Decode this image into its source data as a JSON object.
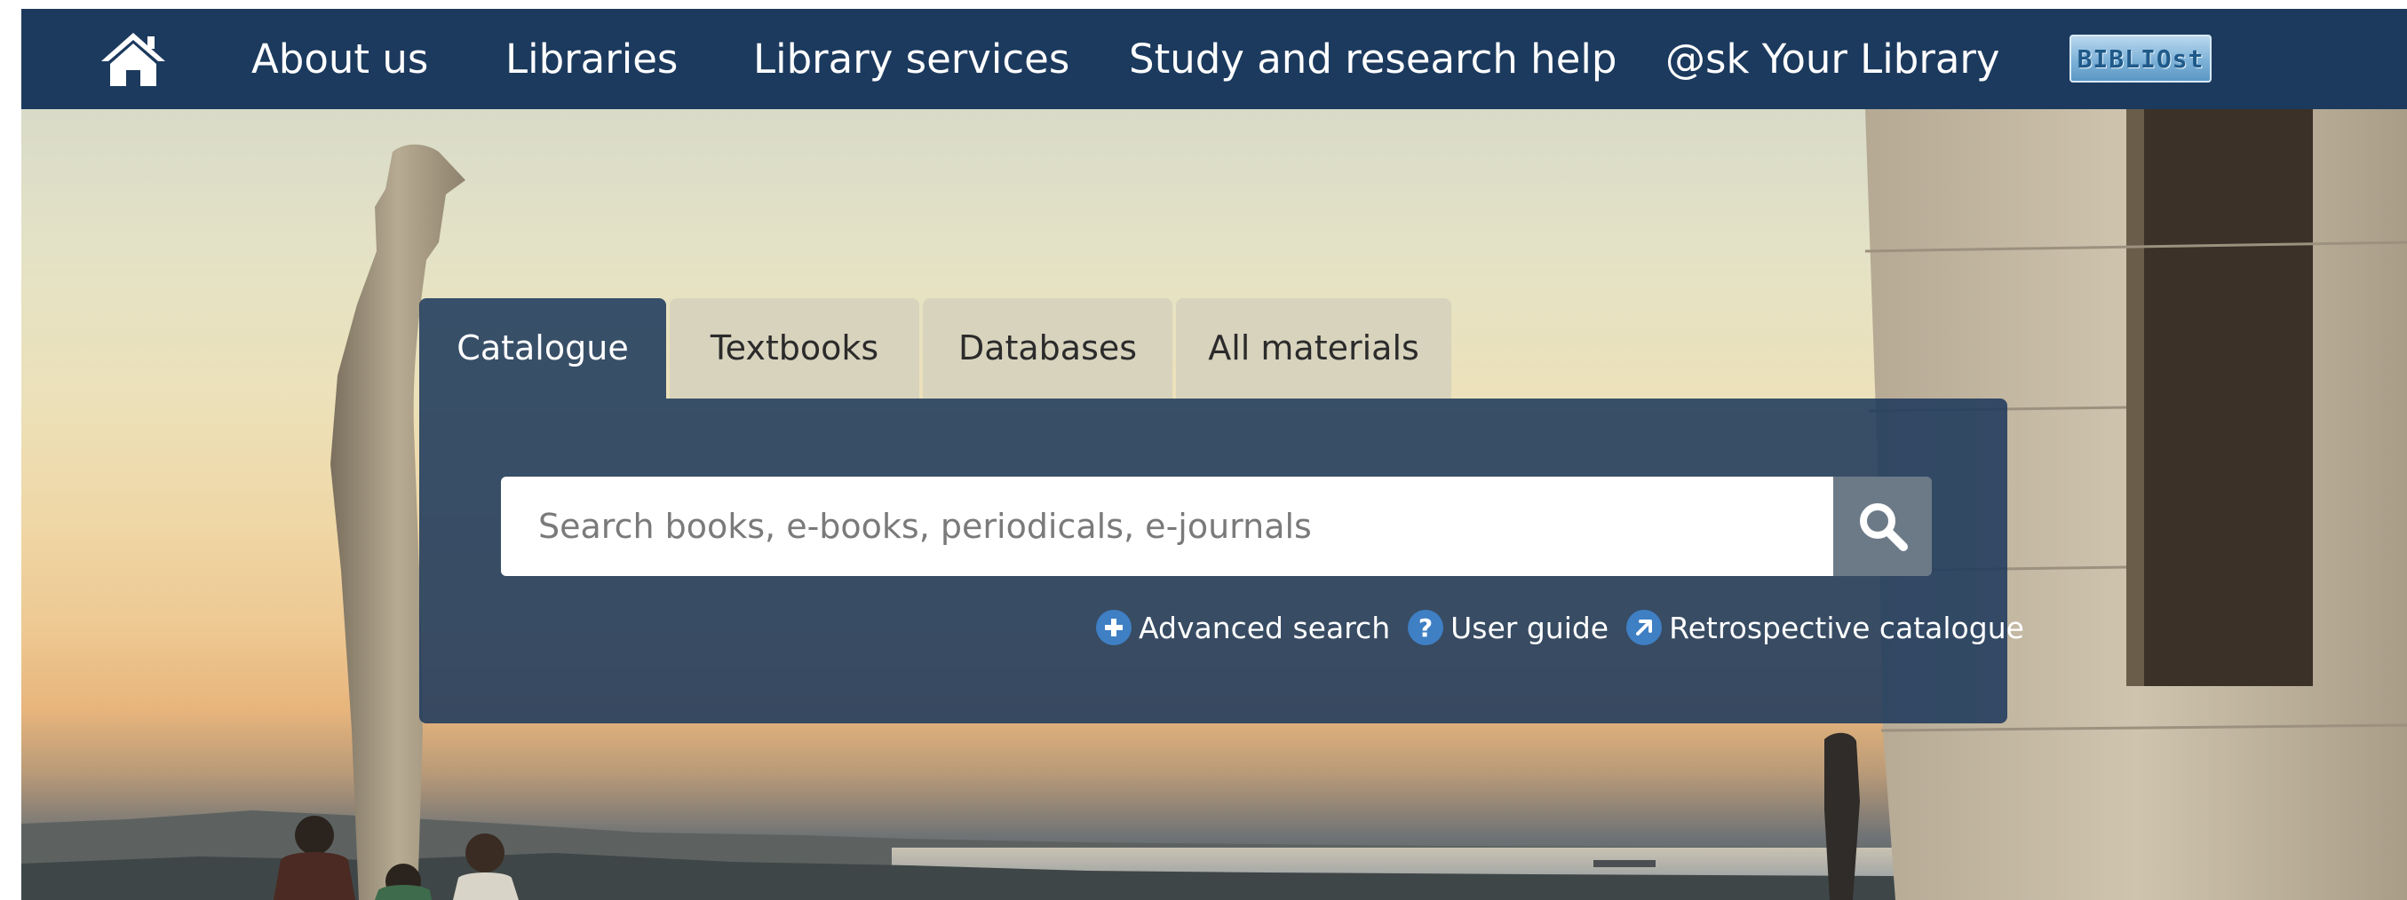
{
  "nav": {
    "home_icon": "home-icon",
    "items": [
      {
        "label": "About us"
      },
      {
        "label": "Libraries"
      },
      {
        "label": "Library services"
      },
      {
        "label": "Study and research help"
      },
      {
        "label": "@sk Your Library"
      }
    ],
    "logo_text": "BIBLIOst"
  },
  "search": {
    "tabs": [
      {
        "label": "Catalogue",
        "active": true
      },
      {
        "label": "Textbooks",
        "active": false
      },
      {
        "label": "Databases",
        "active": false
      },
      {
        "label": "All materials",
        "active": false
      }
    ],
    "placeholder": "Search books, e-books, periodicals, e-journals",
    "button_icon": "search-icon",
    "links": [
      {
        "label": "Advanced search",
        "icon": "plus-circle-icon"
      },
      {
        "label": "User guide",
        "icon": "question-circle-icon"
      },
      {
        "label": "Retrospective catalogue",
        "icon": "external-arrow-circle-icon"
      }
    ]
  },
  "colors": {
    "navbar": "#1c3a5e",
    "panel": "#1f3a5c",
    "tab_inactive": "#d8d3bd",
    "link_icon": "#3f7fc4",
    "search_button": "#6c7a88"
  }
}
